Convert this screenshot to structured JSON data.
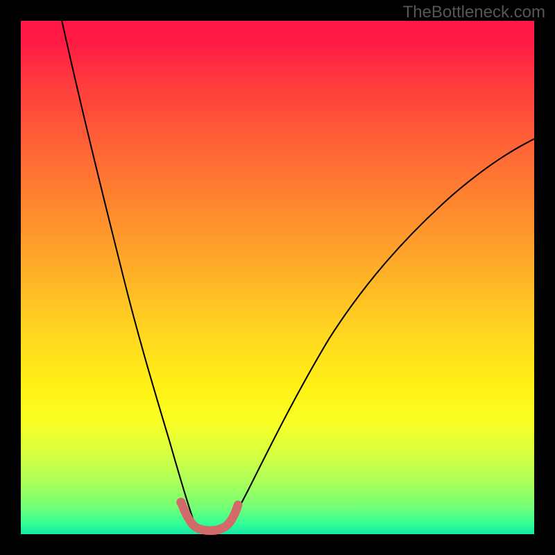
{
  "watermark": "TheBottleneck.com",
  "chart_data": {
    "type": "line",
    "title": "",
    "xlabel": "",
    "ylabel": "",
    "xlim": [
      0,
      100
    ],
    "ylim": [
      0,
      100
    ],
    "grid": false,
    "series": [
      {
        "name": "left-curve",
        "color": "#000000",
        "x": [
          8,
          11,
          14,
          17,
          20,
          23,
          26,
          28,
          30,
          31.5,
          33,
          34
        ],
        "y": [
          100,
          84,
          69,
          55,
          43,
          32,
          22,
          15,
          9,
          5,
          2.5,
          1.5
        ]
      },
      {
        "name": "right-curve",
        "color": "#000000",
        "x": [
          40,
          42,
          45,
          49,
          54,
          60,
          67,
          75,
          84,
          93,
          100
        ],
        "y": [
          1.5,
          3,
          7,
          14,
          23,
          33,
          44,
          54,
          63,
          70,
          75
        ]
      },
      {
        "name": "accent-valley",
        "color": "#d36a6a",
        "x": [
          31,
          32,
          33,
          34,
          35,
          36,
          37,
          38,
          39,
          40,
          41,
          42
        ],
        "y": [
          6,
          3.5,
          2,
          1.3,
          1,
          1,
          1,
          1,
          1.3,
          2,
          3.6,
          6
        ]
      }
    ],
    "gradient_stops": [
      {
        "pos": 0.0,
        "color": "#ff1745"
      },
      {
        "pos": 0.28,
        "color": "#ff6f34"
      },
      {
        "pos": 0.6,
        "color": "#ffd420"
      },
      {
        "pos": 0.78,
        "color": "#faff24"
      },
      {
        "pos": 0.95,
        "color": "#6fff78"
      },
      {
        "pos": 1.0,
        "color": "#18e7a8"
      }
    ]
  }
}
